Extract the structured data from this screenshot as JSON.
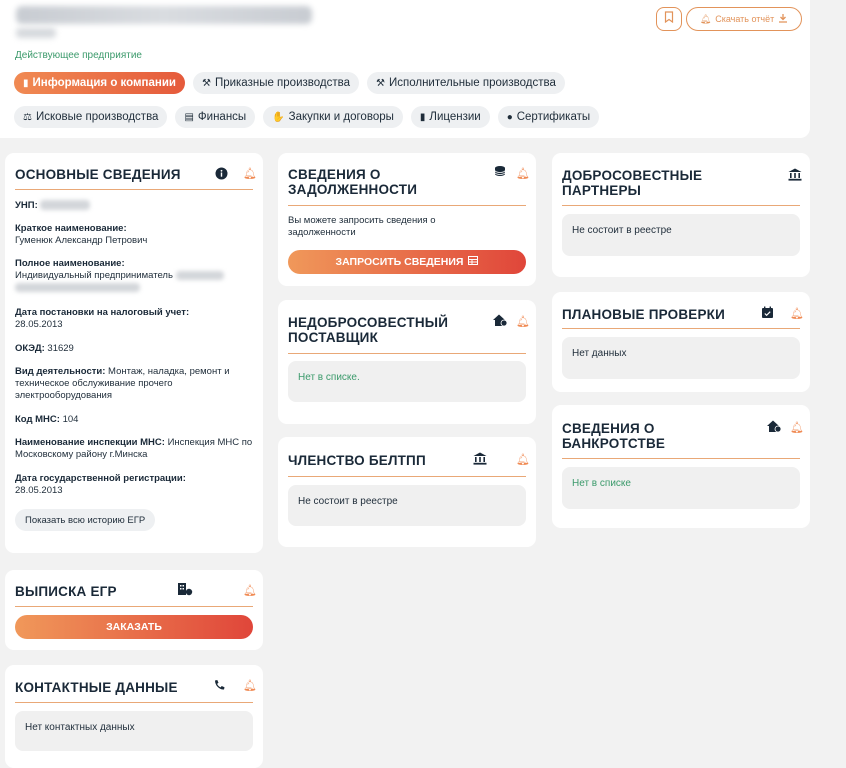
{
  "header": {
    "status": "Действующее предприятие",
    "download_label": "Скачать отчёт",
    "tabs_row1": [
      {
        "icon": "▮",
        "label": "Информация о компании"
      },
      {
        "icon": "⚒",
        "label": "Приказные производства"
      },
      {
        "icon": "⚒",
        "label": "Исполнительные производства"
      }
    ],
    "tabs_row2": [
      {
        "icon": "⚖",
        "label": "Исковые производства"
      },
      {
        "icon": "▤",
        "label": "Финансы"
      },
      {
        "icon": "✋",
        "label": "Закупки и договоры"
      },
      {
        "icon": "▮",
        "label": "Лицензии"
      },
      {
        "icon": "●",
        "label": "Сертификаты"
      }
    ]
  },
  "basic": {
    "title": "ОСНОВНЫЕ СВЕДЕНИЯ",
    "unp_label": "УНП:",
    "short_name_label": "Краткое наименование:",
    "short_name_value": "Гуменюк Александр Петрович",
    "full_name_label": "Полное наименование:",
    "full_name_value": "Индивидуальный предприниматель",
    "tax_date_label": "Дата постановки на налоговый учет:",
    "tax_date_value": "28.05.2013",
    "okved_label": "ОКЭД:",
    "okved_value": "31629",
    "activity_label": "Вид деятельности:",
    "activity_value": "Монтаж, наладка, ремонт и техническое обслуживание прочего электрооборудования",
    "mns_code_label": "Код МНС:",
    "mns_code_value": "104",
    "mns_name_label": "Наименование инспекции МНС:",
    "mns_name_value": "Инспекция МНС по Московскому району г.Минска",
    "reg_date_label": "Дата государственной регистрации:",
    "reg_date_value": "28.05.2013",
    "history_button": "Показать всю историю ЕГР"
  },
  "egr": {
    "title": "ВЫПИСКА ЕГР",
    "button": "ЗАКАЗАТЬ"
  },
  "contacts": {
    "title": "КОНТАКТНЫЕ ДАННЫЕ",
    "value": "Нет контактных данных"
  },
  "debt": {
    "title": "СВЕДЕНИЯ О ЗАДОЛЖЕННОСТИ",
    "text": "Вы можете запросить сведения о задолженности",
    "button": "ЗАПРОСИТЬ СВЕДЕНИЯ"
  },
  "unfair": {
    "title": "НЕДОБРОСОВЕСТНЫЙ ПОСТАВЩИК",
    "value": "Нет в списке."
  },
  "belcci": {
    "title": "ЧЛЕНСТВО БЕЛТПП",
    "value": "Не состоит в реестре"
  },
  "partners": {
    "title": "ДОБРОСОВЕСТНЫЕ ПАРТНЕРЫ",
    "value": "Не состоит в реестре"
  },
  "checks": {
    "title": "ПЛАНОВЫЕ ПРОВЕРКИ",
    "value": "Нет данных"
  },
  "bankrupt": {
    "title": "СВЕДЕНИЯ О БАНКРОТСТВЕ",
    "value": "Нет в списке"
  },
  "colors": {
    "accent": "#f08a53",
    "green": "#3b9a6b",
    "dark": "#1a2938"
  }
}
